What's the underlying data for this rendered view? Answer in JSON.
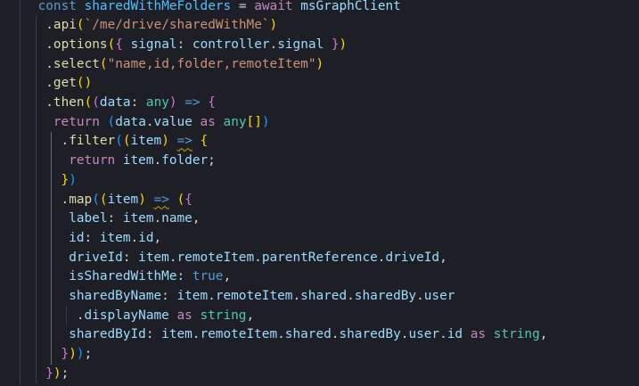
{
  "editor": {
    "language": "typescript",
    "theme": "dark",
    "colors": {
      "background": "#1e1f26",
      "keyword_declaration": "#569cd6",
      "keyword_control": "#c586c0",
      "variable": "#9cdcfe",
      "constant": "#4fc1ff",
      "function": "#dcdcaa",
      "string": "#ce9178",
      "type": "#4ec9b0",
      "bracket_level_1": "#ffd700",
      "bracket_level_2": "#da70d6",
      "bracket_level_3": "#179fff",
      "warning_squiggle": "#cca700"
    },
    "lines": [
      {
        "indent": 4,
        "tokens": [
          {
            "t": "const ",
            "c": "kw-blue"
          },
          {
            "t": "sharedWithMeFolders",
            "c": "var-name"
          },
          {
            "t": " = ",
            "c": "punct"
          },
          {
            "t": "await ",
            "c": "ctrl"
          },
          {
            "t": "msGraphClient",
            "c": "var"
          }
        ]
      },
      {
        "indent": 5,
        "tokens": [
          {
            "t": ".",
            "c": "punct"
          },
          {
            "t": "api",
            "c": "fn"
          },
          {
            "t": "(",
            "c": "b1"
          },
          {
            "t": "`/me/drive/sharedWithMe`",
            "c": "str"
          },
          {
            "t": ")",
            "c": "b1"
          }
        ]
      },
      {
        "indent": 5,
        "tokens": [
          {
            "t": ".",
            "c": "punct"
          },
          {
            "t": "options",
            "c": "fn"
          },
          {
            "t": "(",
            "c": "b1"
          },
          {
            "t": "{",
            "c": "b2"
          },
          {
            "t": " signal",
            "c": "var"
          },
          {
            "t": ": ",
            "c": "punct"
          },
          {
            "t": "controller",
            "c": "var"
          },
          {
            "t": ".",
            "c": "punct"
          },
          {
            "t": "signal",
            "c": "var"
          },
          {
            "t": " ",
            "c": "punct"
          },
          {
            "t": "}",
            "c": "b2"
          },
          {
            "t": ")",
            "c": "b1"
          }
        ]
      },
      {
        "indent": 5,
        "tokens": [
          {
            "t": ".",
            "c": "punct"
          },
          {
            "t": "select",
            "c": "fn"
          },
          {
            "t": "(",
            "c": "b1"
          },
          {
            "t": "\"name,id,folder,remoteItem\"",
            "c": "str"
          },
          {
            "t": ")",
            "c": "b1"
          }
        ]
      },
      {
        "indent": 5,
        "tokens": [
          {
            "t": ".",
            "c": "punct"
          },
          {
            "t": "get",
            "c": "fn"
          },
          {
            "t": "(",
            "c": "b1"
          },
          {
            "t": ")",
            "c": "b1"
          }
        ]
      },
      {
        "indent": 5,
        "tokens": [
          {
            "t": ".",
            "c": "punct"
          },
          {
            "t": "then",
            "c": "fn"
          },
          {
            "t": "(",
            "c": "b1"
          },
          {
            "t": "(",
            "c": "b2"
          },
          {
            "t": "data",
            "c": "var"
          },
          {
            "t": ": ",
            "c": "punct"
          },
          {
            "t": "any",
            "c": "type"
          },
          {
            "t": ")",
            "c": "b2"
          },
          {
            "t": " => ",
            "c": "kw-blue"
          },
          {
            "t": "{",
            "c": "b2"
          }
        ]
      },
      {
        "indent": 6,
        "tokens": [
          {
            "t": "return ",
            "c": "ctrl"
          },
          {
            "t": "(",
            "c": "b3"
          },
          {
            "t": "data",
            "c": "var"
          },
          {
            "t": ".",
            "c": "punct"
          },
          {
            "t": "value",
            "c": "var"
          },
          {
            "t": " as ",
            "c": "ctrl"
          },
          {
            "t": "any",
            "c": "type"
          },
          {
            "t": "[]",
            "c": "b1"
          },
          {
            "t": ")",
            "c": "b3"
          }
        ]
      },
      {
        "indent": 7,
        "tokens": [
          {
            "t": ".",
            "c": "punct"
          },
          {
            "t": "filter",
            "c": "fn"
          },
          {
            "t": "(",
            "c": "b3"
          },
          {
            "t": "(",
            "c": "b1"
          },
          {
            "t": "item",
            "c": "var"
          },
          {
            "t": ")",
            "c": "b1"
          },
          {
            "t": " ",
            "c": "punct"
          },
          {
            "t": "=>",
            "c": "kw-blue",
            "squiggle": true
          },
          {
            "t": " ",
            "c": "punct"
          },
          {
            "t": "{",
            "c": "b1"
          }
        ]
      },
      {
        "indent": 8,
        "tokens": [
          {
            "t": "return ",
            "c": "ctrl"
          },
          {
            "t": "item",
            "c": "var"
          },
          {
            "t": ".",
            "c": "punct"
          },
          {
            "t": "folder",
            "c": "var"
          },
          {
            "t": ";",
            "c": "punct"
          }
        ]
      },
      {
        "indent": 7,
        "tokens": [
          {
            "t": "}",
            "c": "b1"
          },
          {
            "t": ")",
            "c": "b3"
          }
        ]
      },
      {
        "indent": 7,
        "tokens": [
          {
            "t": ".",
            "c": "punct"
          },
          {
            "t": "map",
            "c": "fn"
          },
          {
            "t": "(",
            "c": "b3"
          },
          {
            "t": "(",
            "c": "b1"
          },
          {
            "t": "item",
            "c": "var"
          },
          {
            "t": ")",
            "c": "b1"
          },
          {
            "t": " ",
            "c": "punct"
          },
          {
            "t": "=>",
            "c": "kw-blue",
            "squiggle": true
          },
          {
            "t": " ",
            "c": "punct"
          },
          {
            "t": "(",
            "c": "b1"
          },
          {
            "t": "{",
            "c": "b2"
          }
        ]
      },
      {
        "indent": 8,
        "tokens": [
          {
            "t": "label",
            "c": "var"
          },
          {
            "t": ": ",
            "c": "punct"
          },
          {
            "t": "item",
            "c": "var"
          },
          {
            "t": ".",
            "c": "punct"
          },
          {
            "t": "name",
            "c": "var"
          },
          {
            "t": ",",
            "c": "punct"
          }
        ]
      },
      {
        "indent": 8,
        "tokens": [
          {
            "t": "id",
            "c": "var"
          },
          {
            "t": ": ",
            "c": "punct"
          },
          {
            "t": "item",
            "c": "var"
          },
          {
            "t": ".",
            "c": "punct"
          },
          {
            "t": "id",
            "c": "var"
          },
          {
            "t": ",",
            "c": "punct"
          }
        ]
      },
      {
        "indent": 8,
        "tokens": [
          {
            "t": "driveId",
            "c": "var"
          },
          {
            "t": ": ",
            "c": "punct"
          },
          {
            "t": "item",
            "c": "var"
          },
          {
            "t": ".",
            "c": "punct"
          },
          {
            "t": "remoteItem",
            "c": "var"
          },
          {
            "t": ".",
            "c": "punct"
          },
          {
            "t": "parentReference",
            "c": "var"
          },
          {
            "t": ".",
            "c": "punct"
          },
          {
            "t": "driveId",
            "c": "var"
          },
          {
            "t": ",",
            "c": "punct"
          }
        ]
      },
      {
        "indent": 8,
        "tokens": [
          {
            "t": "isSharedWithMe",
            "c": "var"
          },
          {
            "t": ": ",
            "c": "punct"
          },
          {
            "t": "true",
            "c": "kw-blue"
          },
          {
            "t": ",",
            "c": "punct"
          }
        ]
      },
      {
        "indent": 8,
        "tokens": [
          {
            "t": "sharedByName",
            "c": "var"
          },
          {
            "t": ": ",
            "c": "punct"
          },
          {
            "t": "item",
            "c": "var"
          },
          {
            "t": ".",
            "c": "punct"
          },
          {
            "t": "remoteItem",
            "c": "var"
          },
          {
            "t": ".",
            "c": "punct"
          },
          {
            "t": "shared",
            "c": "var"
          },
          {
            "t": ".",
            "c": "punct"
          },
          {
            "t": "sharedBy",
            "c": "var"
          },
          {
            "t": ".",
            "c": "punct"
          },
          {
            "t": "user",
            "c": "var"
          }
        ]
      },
      {
        "indent": 9,
        "tokens": [
          {
            "t": ".",
            "c": "punct"
          },
          {
            "t": "displayName",
            "c": "var"
          },
          {
            "t": " as ",
            "c": "ctrl"
          },
          {
            "t": "string",
            "c": "type"
          },
          {
            "t": ",",
            "c": "punct"
          }
        ]
      },
      {
        "indent": 8,
        "tokens": [
          {
            "t": "sharedById",
            "c": "var"
          },
          {
            "t": ": ",
            "c": "punct"
          },
          {
            "t": "item",
            "c": "var"
          },
          {
            "t": ".",
            "c": "punct"
          },
          {
            "t": "remoteItem",
            "c": "var"
          },
          {
            "t": ".",
            "c": "punct"
          },
          {
            "t": "shared",
            "c": "var"
          },
          {
            "t": ".",
            "c": "punct"
          },
          {
            "t": "sharedBy",
            "c": "var"
          },
          {
            "t": ".",
            "c": "punct"
          },
          {
            "t": "user",
            "c": "var"
          },
          {
            "t": ".",
            "c": "punct"
          },
          {
            "t": "id",
            "c": "var"
          },
          {
            "t": " as ",
            "c": "ctrl"
          },
          {
            "t": "string",
            "c": "type"
          },
          {
            "t": ",",
            "c": "punct"
          }
        ]
      },
      {
        "indent": 7,
        "tokens": [
          {
            "t": "}",
            "c": "b2"
          },
          {
            "t": ")",
            "c": "b1"
          },
          {
            "t": ")",
            "c": "b3"
          },
          {
            "t": ";",
            "c": "punct"
          }
        ]
      },
      {
        "indent": 5,
        "tokens": [
          {
            "t": "}",
            "c": "b2"
          },
          {
            "t": ")",
            "c": "b1"
          },
          {
            "t": ";",
            "c": "punct"
          }
        ]
      }
    ]
  }
}
